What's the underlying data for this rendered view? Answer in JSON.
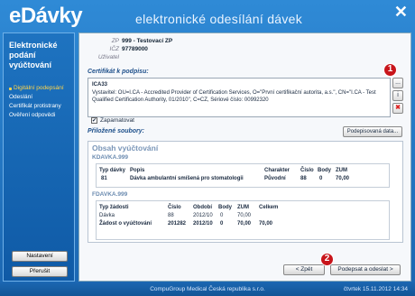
{
  "app": {
    "logo": "eDávky",
    "title": "elektronické odesílání dávek"
  },
  "sidebar": {
    "title": "Elektronické podání vyúčtování",
    "steps": [
      {
        "label": "Digitální podepsání",
        "active": true
      },
      {
        "label": "Odeslání",
        "active": false
      },
      {
        "label": "Certifikát protistrany",
        "active": false
      },
      {
        "label": "Ověření odpovědi",
        "active": false
      }
    ],
    "settings_label": "Nastavení",
    "cancel_label": "Přerušit"
  },
  "header": {
    "zp_label": "ZP",
    "zp_value": "999 - Testovací ZP",
    "icz_label": "IČZ",
    "icz_value": "97789000",
    "user_label": "Uživatel"
  },
  "certificate": {
    "label": "Certifikát k podpisu:",
    "name": "ICA33",
    "text": "Vystavitel: OU=I.CA - Accredited Provider of Certification Services, O=\"První certifikační autorita, a.s.\", CN=\"I.CA - Test Qualified Certification Authority, 01/2010\", C=CZ, Sériové číslo: 00992320",
    "browse_label": "...",
    "info_label": "i",
    "remove_label": "✖"
  },
  "remember": {
    "label": "Zapamatovat",
    "checked": true
  },
  "attachments": {
    "label": "Přiložené soubory:",
    "signed_data_label": "Podepisovaná data..."
  },
  "content": {
    "title": "Obsah vyúčtování",
    "kdavka": {
      "section": "KDAVKA.999",
      "headers": [
        "Typ dávky",
        "Popis",
        "Charakter",
        "Číslo",
        "Body",
        "ZUM"
      ],
      "rows": [
        [
          "81",
          "Dávka ambulantní smíšená pro stomatologii",
          "Původní",
          "88",
          "0",
          "70,00"
        ]
      ]
    },
    "fdavka": {
      "section": "FDAVKA.999",
      "headers": [
        "Typ žádosti",
        "Číslo",
        "Období",
        "Body",
        "ZUM",
        "Celkem"
      ],
      "rows": [
        [
          "Dávka",
          "88",
          "2012/10",
          "0",
          "70,00",
          ""
        ],
        [
          "Žádost o vyúčtování",
          "201282",
          "2012/10",
          "0",
          "70,00",
          "70,00"
        ]
      ]
    }
  },
  "nav": {
    "back_label": "< Zpět",
    "sign_label": "Podepsat a odeslat >"
  },
  "markers": [
    "1",
    "2"
  ],
  "status": {
    "company": "CompuGroup Medical Česká republika s.r.o.",
    "date": "čtvrtek 15.11.2012 14:34"
  },
  "colors": {
    "brand": "#1f6fb8",
    "accent": "#ffd54a",
    "marker": "#c8151b"
  }
}
